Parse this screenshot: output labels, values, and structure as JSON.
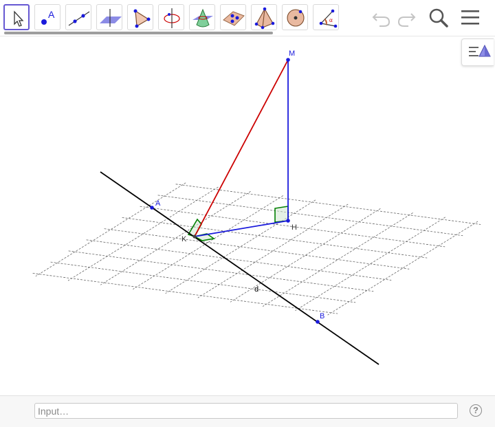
{
  "toolbar": {
    "tools": [
      {
        "name": "move-tool",
        "icon": "arrow-cursor-icon",
        "selected": true
      },
      {
        "name": "point-tool",
        "icon": "point-icon",
        "label": "A"
      },
      {
        "name": "line-tool",
        "icon": "line-icon"
      },
      {
        "name": "perpendicular-plane-tool",
        "icon": "perpendicular-plane-icon"
      },
      {
        "name": "polygon-tool",
        "icon": "triangle-icon"
      },
      {
        "name": "circle-axis-tool",
        "icon": "circle-around-axis-icon"
      },
      {
        "name": "intersect-surfaces-tool",
        "icon": "cone-intersection-icon"
      },
      {
        "name": "plane-through-points-tool",
        "icon": "plane-points-icon"
      },
      {
        "name": "pyramid-tool",
        "icon": "pyramid-icon"
      },
      {
        "name": "sphere-tool",
        "icon": "sphere-icon"
      },
      {
        "name": "angle-tool",
        "icon": "angle-icon",
        "label": "α"
      }
    ],
    "undo": "undo-icon",
    "redo": "redo-icon",
    "search": "search-icon",
    "menu": "hamburger-menu-icon"
  },
  "view_toggle": "graphics-view-3d-icon",
  "graphics": {
    "points": {
      "A": "A",
      "B": "B",
      "K": "K",
      "H": "H",
      "M": "M"
    },
    "line_label": "d",
    "colors": {
      "line_d": "#000000",
      "segment_MK": "#cc0000",
      "segment_MH": "#1a1adc",
      "segment_KH": "#1a1adc",
      "right_angle": "#007f00",
      "points": "#1a1adc",
      "grid": "#666666"
    }
  },
  "input_bar": {
    "placeholder": "Input…",
    "help": "?"
  }
}
